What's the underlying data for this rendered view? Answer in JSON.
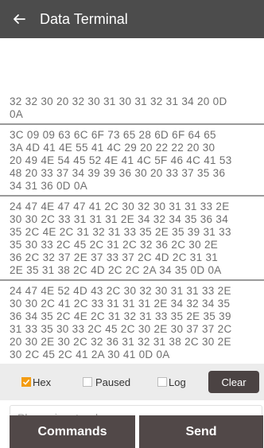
{
  "header": {
    "title": "Data Terminal",
    "back_icon": "arrow-left-icon"
  },
  "terminal": {
    "blocks": [
      [
        "32 32 30 20 32 30 31 30 31 32 31 34 20 0D",
        "0A"
      ],
      [
        "3C 09 09 63 6C 6F 73 65 28 6D 6F 64 65",
        "3A 4D 41 4E 55 41 4C 29 20 22 22 20 30",
        "20 49 4E 54 45 52 4E 41 4C 5F 46 4C 41 53",
        "48 20 33 37 34 39 39 36 30 20 33 37 35 36",
        "34 31 36 0D 0A"
      ],
      [
        "24 47 4E 47 47 41 2C 30 32 30 31 31 33 2E",
        "30 30 2C 33 31 31 31 2E 34 32 34 35 36 34",
        "35 2C 4E 2C 31 32 31 33 35 2E 35 39 31 33",
        "35 30 33 2C 45 2C 31 2C 32 36 2C 30 2E",
        "36 2C 32 37 2E 37 33 37 2C 4D 2C 31 31",
        "2E 35 31 38 2C 4D 2C 2C 2A 34 35 0D 0A"
      ],
      [
        "24 47 4E 52 4D 43 2C 30 32 30 31 31 33 2E",
        "30 30 2C 41 2C 33 31 31 31 2E 34 32 34 35",
        "36 34 35 2C 4E 2C 31 32 31 33 35 2E 35 39",
        "31 33 35 30 33 2C 45 2C 30 2E 30 37 37 2C",
        "20 30 2E 30 2C 32 36 31 32 31 38 2C 30 2E",
        "30 2C 45 2C 41 2A 30 41 0D 0A"
      ]
    ]
  },
  "options": {
    "hex": {
      "label": "Hex",
      "checked": true
    },
    "paused": {
      "label": "Paused",
      "checked": false
    },
    "log": {
      "label": "Log",
      "checked": false
    },
    "clear_label": "Clear"
  },
  "input": {
    "placeholder": "Please input order",
    "value": ""
  },
  "actions": {
    "commands_label": "Commands",
    "send_label": "Send"
  },
  "colors": {
    "header": "#4c4c4c",
    "accent": "#f39c12",
    "button": "#514848"
  }
}
